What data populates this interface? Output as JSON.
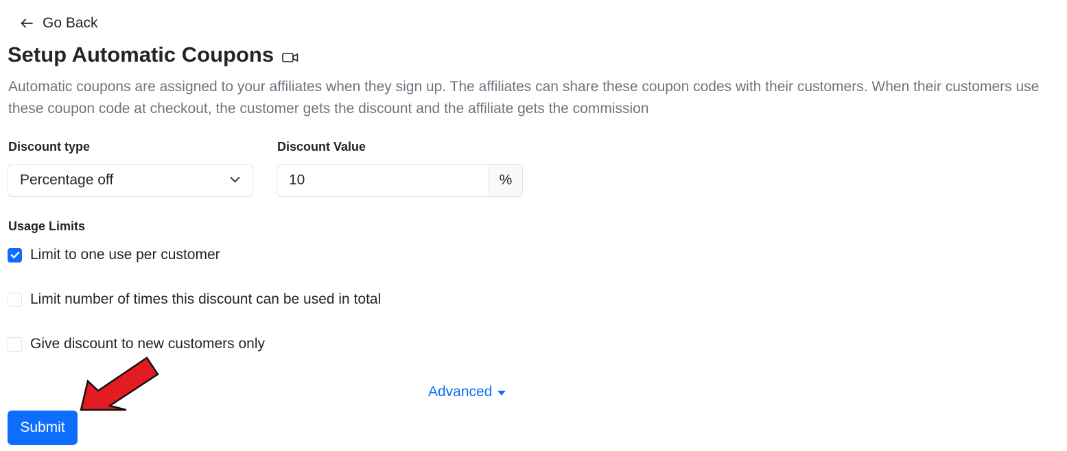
{
  "nav": {
    "back_label": "Go Back"
  },
  "page": {
    "title": "Setup Automatic Coupons",
    "title_icon": "video-camera-icon",
    "description": "Automatic coupons are assigned to your affiliates when they sign up. The affiliates can share these coupon codes with their customers. When their customers use these coupon code at checkout, the customer gets the discount and the affiliate gets the commission"
  },
  "form": {
    "discount_type": {
      "label": "Discount type",
      "selected": "Percentage off"
    },
    "discount_value": {
      "label": "Discount Value",
      "value": "10",
      "unit": "%"
    },
    "usage_limits": {
      "label": "Usage Limits",
      "options": [
        {
          "label": "Limit to one use per customer",
          "checked": true
        },
        {
          "label": "Limit number of times this discount can be used in total",
          "checked": false
        },
        {
          "label": "Give discount to new customers only",
          "checked": false
        }
      ]
    },
    "advanced_label": "Advanced",
    "submit_label": "Submit"
  },
  "colors": {
    "primary": "#0d6efd",
    "muted_text": "#6c757d",
    "annotation_arrow": "#e31b23"
  }
}
